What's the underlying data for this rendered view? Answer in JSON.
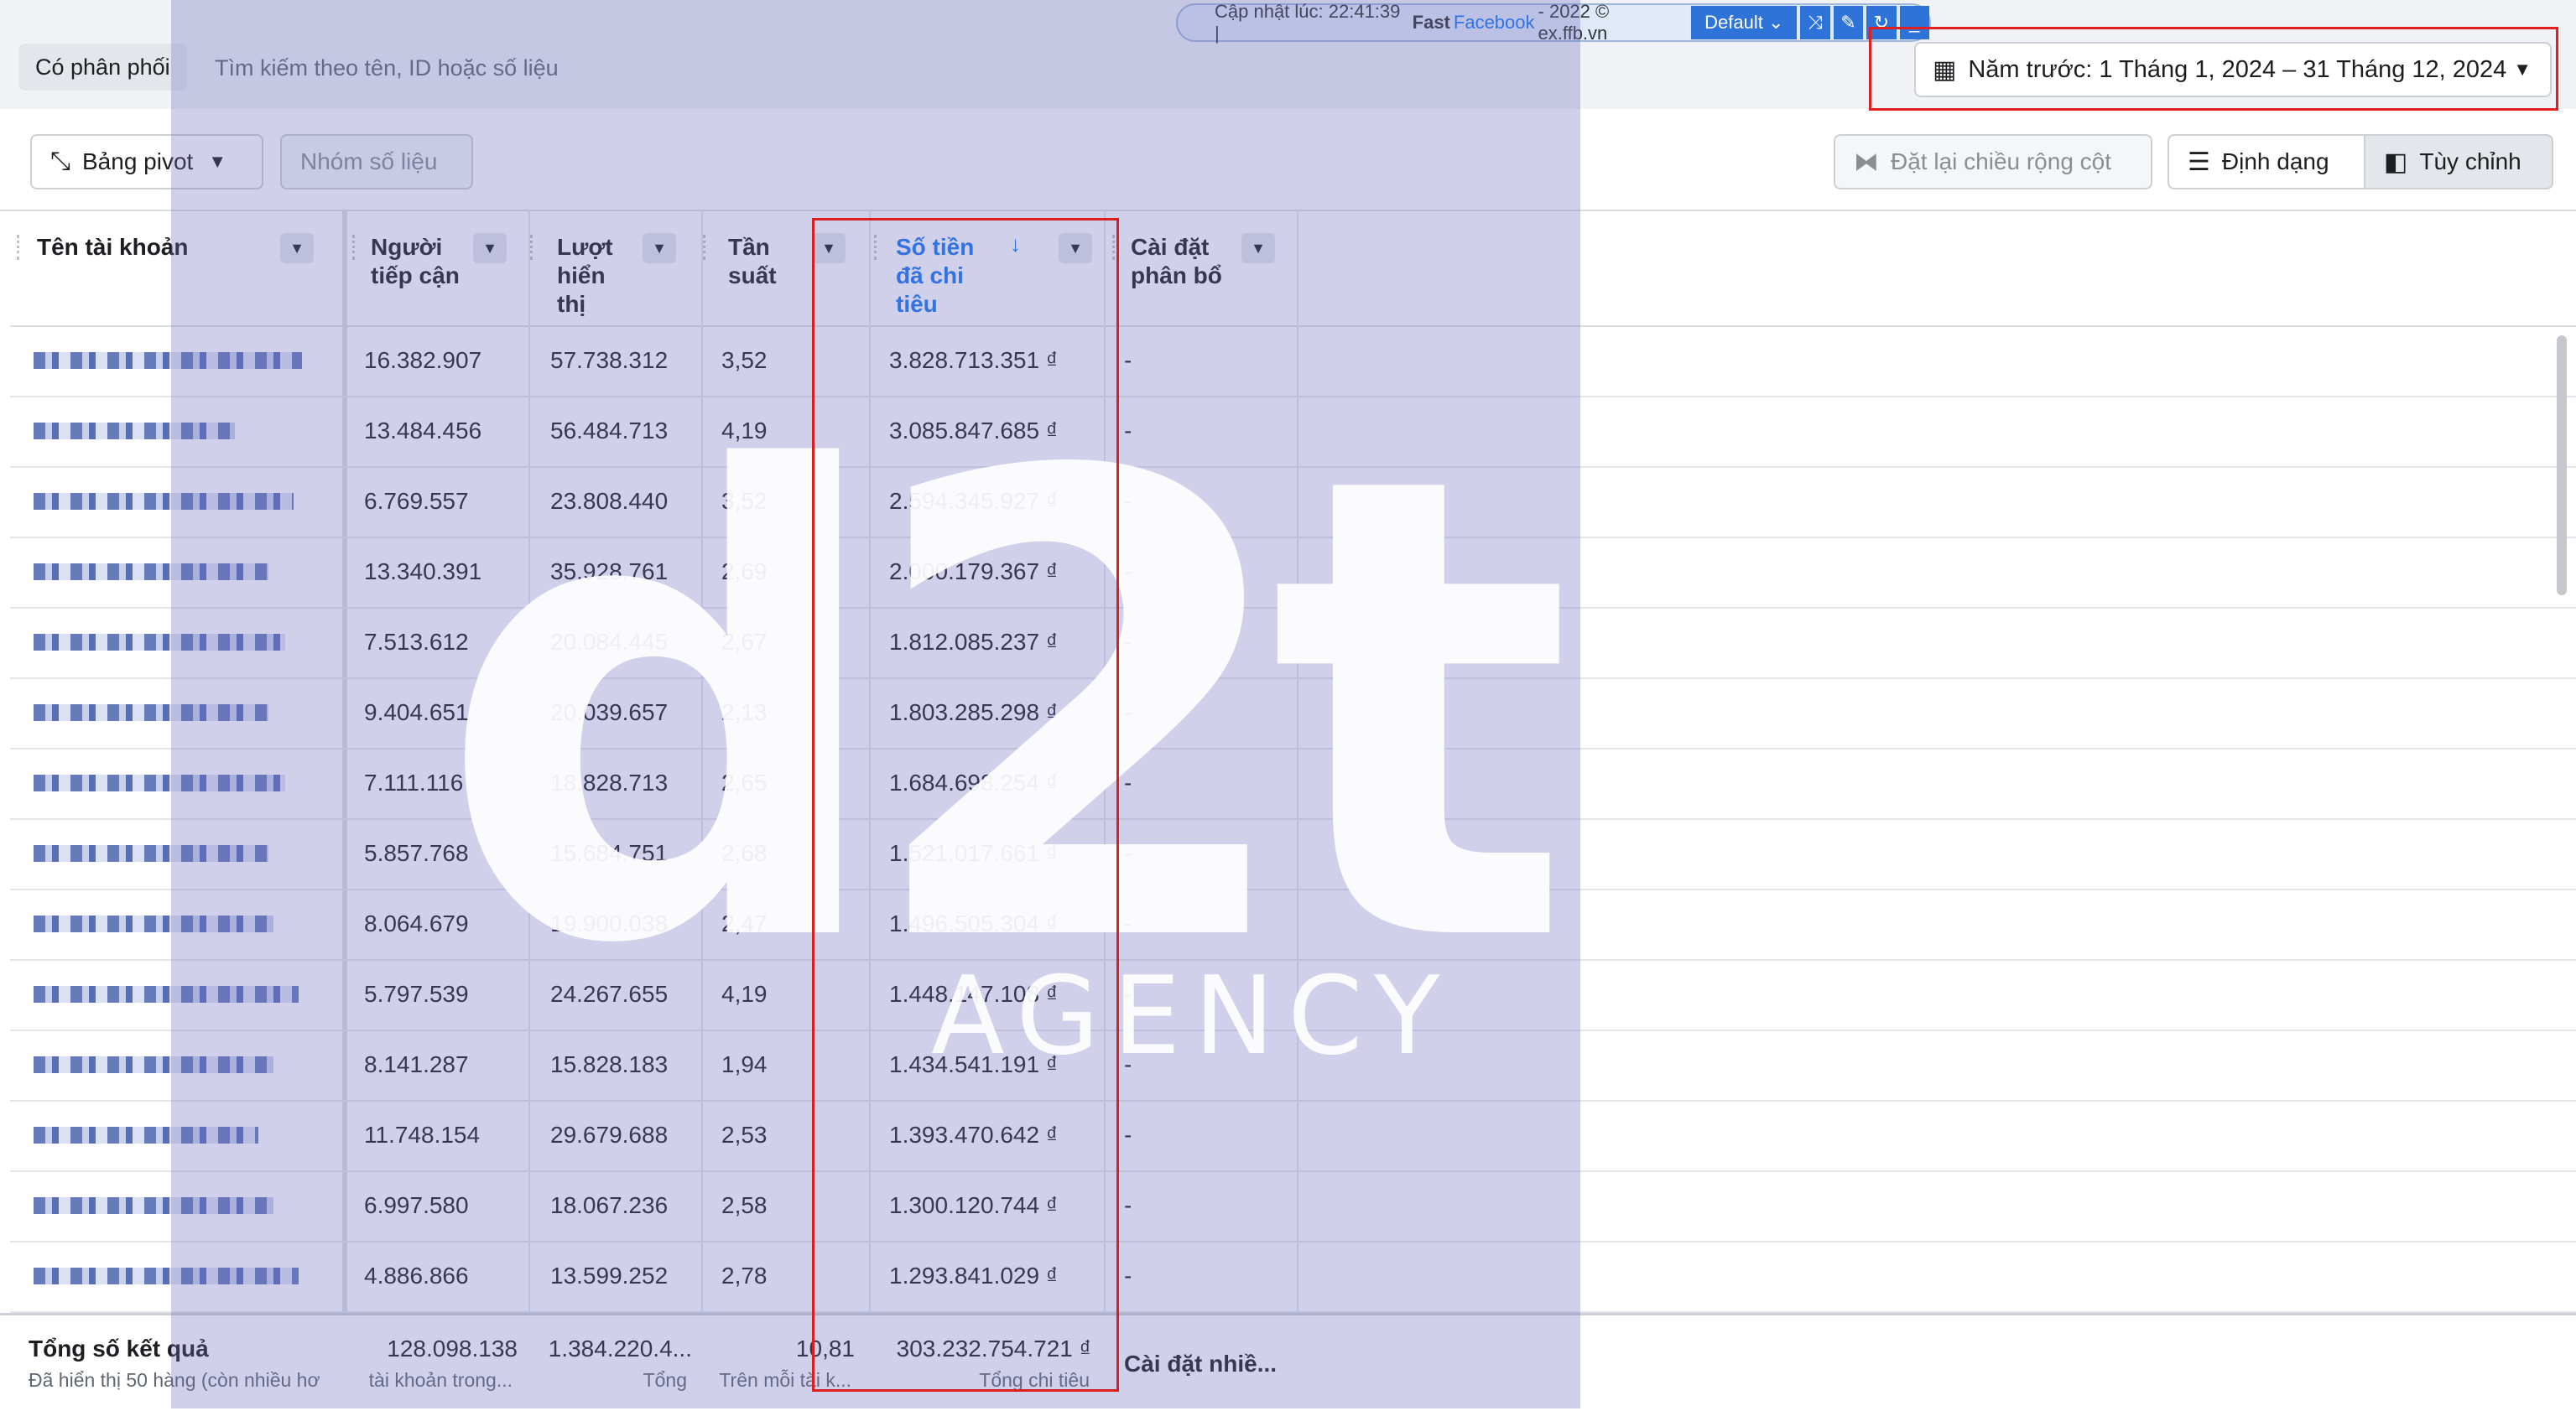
{
  "top": {
    "filter_chip": "Có phân phối",
    "search_placeholder": "Tìm kiếm theo tên, ID hoặc số liệu",
    "extension": {
      "updated_prefix": "Cập nhật lúc: 22:41:39 |",
      "brand_fast": "Fast",
      "brand_facebook": "Facebook",
      "brand_suffix": "- 2022 © ex.ffb.vn",
      "profile": "Default"
    },
    "date_range": "Năm trước: 1 Tháng 1, 2024 – 31 Tháng 12, 2024"
  },
  "toolbar": {
    "pivot_label": "Bảng pivot",
    "group_metrics_label": "Nhóm số liệu",
    "reset_width_label": "Đặt lại chiều rộng cột",
    "format_label": "Định dạng",
    "customize_label": "Tùy chỉnh"
  },
  "table": {
    "headers": {
      "account_name": "Tên tài khoản",
      "reach": [
        "Người",
        "tiếp cận"
      ],
      "impressions": [
        "Lượt",
        "hiển",
        "thị"
      ],
      "frequency": [
        "Tần",
        "suất"
      ],
      "spend": [
        "Số tiền",
        "đã chi",
        "tiêu"
      ],
      "allocation": [
        "Cài đặt",
        "phân bổ"
      ]
    },
    "rows": [
      {
        "reach": "16.382.907",
        "impressions": "57.738.312",
        "frequency": "3,52",
        "spend": "3.828.713.351 ₫",
        "allocation": "-"
      },
      {
        "reach": "13.484.456",
        "impressions": "56.484.713",
        "frequency": "4,19",
        "spend": "3.085.847.685 ₫",
        "allocation": "-"
      },
      {
        "reach": "6.769.557",
        "impressions": "23.808.440",
        "frequency": "3,52",
        "spend": "2.594.345.927 ₫",
        "allocation": "-"
      },
      {
        "reach": "13.340.391",
        "impressions": "35.928.761",
        "frequency": "2,69",
        "spend": "2.000.179.367 ₫",
        "allocation": "-"
      },
      {
        "reach": "7.513.612",
        "impressions": "20.084.445",
        "frequency": "2,67",
        "spend": "1.812.085.237 ₫",
        "allocation": "-"
      },
      {
        "reach": "9.404.651",
        "impressions": "20.039.657",
        "frequency": "2,13",
        "spend": "1.803.285.298 ₫",
        "allocation": "-"
      },
      {
        "reach": "7.111.116",
        "impressions": "18.828.713",
        "frequency": "2,65",
        "spend": "1.684.698.254 ₫",
        "allocation": "-"
      },
      {
        "reach": "5.857.768",
        "impressions": "15.684.751",
        "frequency": "2,68",
        "spend": "1.521.017.661 ₫",
        "allocation": "-"
      },
      {
        "reach": "8.064.679",
        "impressions": "19.900.038",
        "frequency": "2,47",
        "spend": "1.496.505.304 ₫",
        "allocation": "-"
      },
      {
        "reach": "5.797.539",
        "impressions": "24.267.655",
        "frequency": "4,19",
        "spend": "1.448.147.108 ₫",
        "allocation": "-"
      },
      {
        "reach": "8.141.287",
        "impressions": "15.828.183",
        "frequency": "1,94",
        "spend": "1.434.541.191 ₫",
        "allocation": "-"
      },
      {
        "reach": "11.748.154",
        "impressions": "29.679.688",
        "frequency": "2,53",
        "spend": "1.393.470.642 ₫",
        "allocation": "-"
      },
      {
        "reach": "6.997.580",
        "impressions": "18.067.236",
        "frequency": "2,58",
        "spend": "1.300.120.744 ₫",
        "allocation": "-"
      },
      {
        "reach": "4.886.866",
        "impressions": "13.599.252",
        "frequency": "2,78",
        "spend": "1.293.841.029 ₫",
        "allocation": "-"
      }
    ],
    "footer": {
      "title": "Tổng số kết quả",
      "subtitle": "Đã hiển thị 50 hàng (còn nhiều hơ",
      "reach_total": "128.098.138",
      "reach_sub": "tài khoản trong...",
      "impressions_total": "1.384.220.4...",
      "impressions_sub": "Tổng",
      "frequency_total": "10,81",
      "frequency_sub": "Trên mỗi tài k...",
      "spend_total": "303.232.754.721 ₫",
      "spend_sub": "Tổng chi tiêu",
      "allocation_total": "Cài đặt nhiề..."
    }
  },
  "watermark": {
    "logo": "d2t",
    "agency": "AGENCY"
  },
  "colors": {
    "accent": "#1877f2",
    "highlight": "#d92020",
    "overlay": "#6e6ebe"
  }
}
